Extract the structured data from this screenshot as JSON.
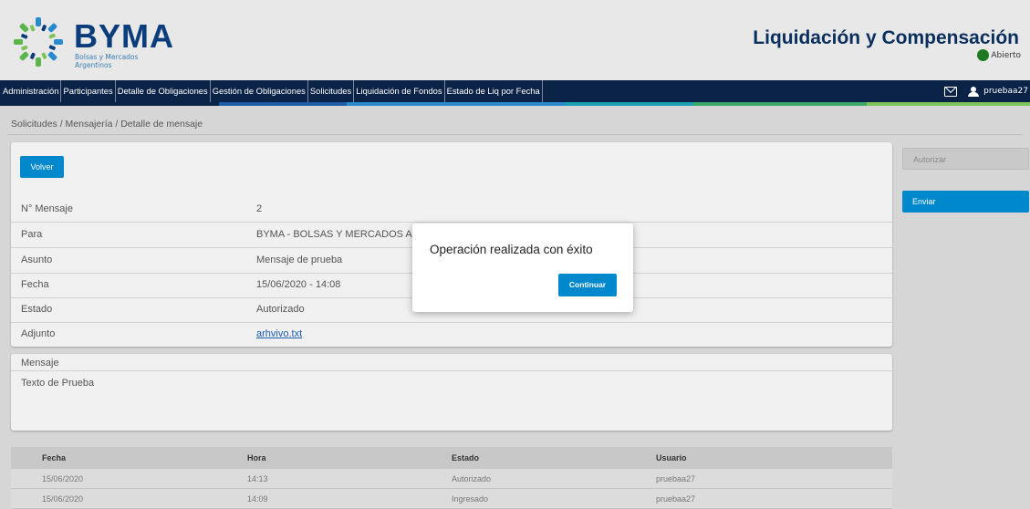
{
  "header": {
    "brand_name": "BYMA",
    "brand_sub": "Bolsas y Mercados Argentinos",
    "app_title": "Liquidación y Compensación",
    "market_status": "Abierto",
    "market_status_color": "#1e7a1e"
  },
  "nav": {
    "items": [
      "Administración",
      "Participantes",
      "Detalle de Obligaciones",
      "Gestión de Obligaciones",
      "Solicitudes",
      "Liquidación de Fondos",
      "Estado de Liq por Fecha"
    ],
    "user": "pruebaa27",
    "icons": [
      "mail-icon",
      "user-icon"
    ]
  },
  "breadcrumb": "Solicitudes / Mensajería / Detalle de mensaje",
  "detail": {
    "back_label": "Volver",
    "fields": [
      {
        "label": "N° Mensaje",
        "value": "2"
      },
      {
        "label": "Para",
        "value": "BYMA - BOLSAS Y MERCADOS A"
      },
      {
        "label": "Asunto",
        "value": "Mensaje de prueba"
      },
      {
        "label": "Fecha",
        "value": "15/06/2020 - 14:08"
      },
      {
        "label": "Estado",
        "value": "Autorizado"
      },
      {
        "label": "Adjunto",
        "value": "arhvivo.txt"
      }
    ]
  },
  "message": {
    "label": "Mensaje",
    "body": "Texto de Prueba"
  },
  "actions": {
    "authorize_label": "Autorizar",
    "send_label": "Enviar"
  },
  "history": {
    "columns": [
      "Fecha",
      "Hora",
      "Estado",
      "Usuario"
    ],
    "rows": [
      [
        "15/06/2020",
        "14:13",
        "Autorizado",
        "pruebaa27"
      ],
      [
        "15/06/2020",
        "14:09",
        "Ingresado",
        "pruebaa27"
      ]
    ]
  },
  "modal": {
    "message": "Operación realizada con éxito",
    "button_label": "Continuar"
  },
  "colors": {
    "primary": "#0088cc",
    "navbar": "#0b2346",
    "title": "#0a2f5c"
  }
}
